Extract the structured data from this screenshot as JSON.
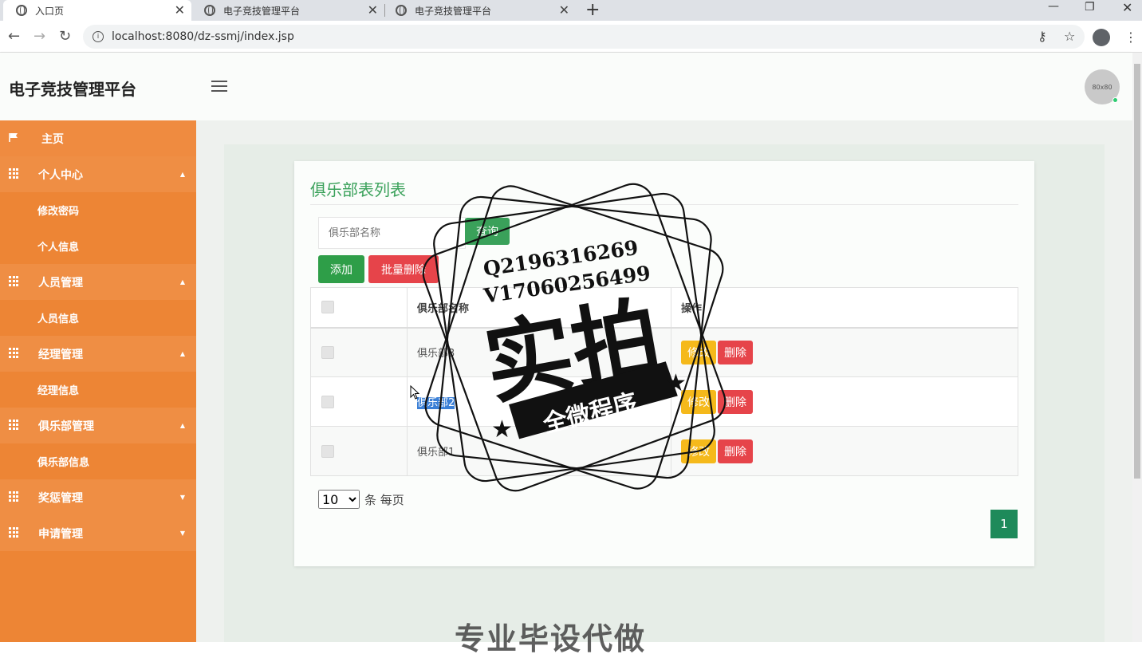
{
  "browser": {
    "tabs": [
      {
        "label": "入口页",
        "active": true
      },
      {
        "label": "电子竞技管理平台",
        "active": false
      },
      {
        "label": "电子竞技管理平台",
        "active": false
      }
    ],
    "url": "localhost:8080/dz-ssmj/index.jsp"
  },
  "header": {
    "brand": "电子竞技管理平台",
    "avatar_text": "80x80"
  },
  "sidebar": {
    "items": [
      {
        "label": "主页",
        "type": "home"
      },
      {
        "label": "个人中心",
        "type": "parent",
        "caret": "▲"
      },
      {
        "label": "修改密码",
        "type": "child"
      },
      {
        "label": "个人信息",
        "type": "child"
      },
      {
        "label": "人员管理",
        "type": "parent",
        "caret": "▲"
      },
      {
        "label": "人员信息",
        "type": "child"
      },
      {
        "label": "经理管理",
        "type": "parent",
        "caret": "▲"
      },
      {
        "label": "经理信息",
        "type": "child"
      },
      {
        "label": "俱乐部管理",
        "type": "parent",
        "caret": "▲"
      },
      {
        "label": "俱乐部信息",
        "type": "child"
      },
      {
        "label": "奖惩管理",
        "type": "parent",
        "caret": "▼"
      },
      {
        "label": "申请管理",
        "type": "parent",
        "caret": "▼"
      }
    ]
  },
  "main": {
    "title": "俱乐部表列表",
    "search_placeholder": "俱乐部名称",
    "query_label": "查询",
    "add_label": "添加",
    "batch_delete_label": "批量删除",
    "table": {
      "headers": [
        "",
        "俱乐部名称",
        "操作"
      ],
      "rows": [
        {
          "name": "俱乐部3"
        },
        {
          "name": "俱乐部2"
        },
        {
          "name": "俱乐部1"
        }
      ],
      "edit_label": "修改",
      "delete_label": "删除"
    },
    "page_size": "10",
    "page_size_suffix": "条 每页",
    "current_page": "1"
  },
  "watermark": {
    "line1": "Q2196316269",
    "line2": "V17060256499",
    "big": "实拍",
    "banner": "全微程序",
    "bottom": "专业毕设代做"
  },
  "colors": {
    "sidebar": "#ed8535",
    "accent_green": "#3aa15a",
    "danger": "#e6444a",
    "warning": "#f5b91b",
    "pager": "#1e8a5a"
  }
}
